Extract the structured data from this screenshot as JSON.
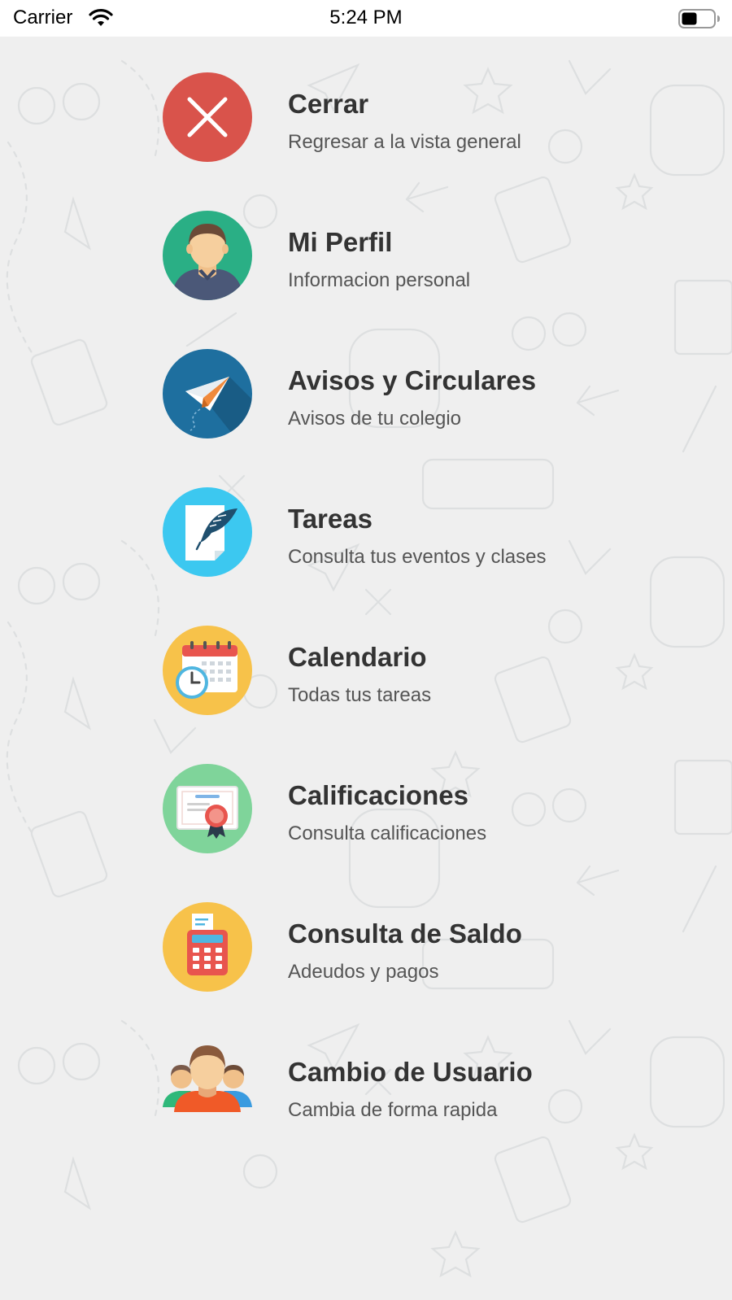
{
  "status_bar": {
    "carrier": "Carrier",
    "time": "5:24 PM",
    "wifi_icon": "wifi-icon",
    "battery_icon": "battery-icon"
  },
  "menu": {
    "items": [
      {
        "title": "Cerrar",
        "subtitle": "Regresar a la vista general",
        "icon": "close-icon",
        "color": "#d9534b"
      },
      {
        "title": "Mi Perfil",
        "subtitle": "Informacion personal",
        "icon": "user-avatar-icon",
        "color": "#2aaf85"
      },
      {
        "title": "Avisos y Circulares",
        "subtitle": "Avisos de tu colegio",
        "icon": "paper-plane-icon",
        "color": "#1e6f9f"
      },
      {
        "title": "Tareas",
        "subtitle": "Consulta tus eventos y clases",
        "icon": "quill-page-icon",
        "color": "#3cc8f0"
      },
      {
        "title": "Calendario",
        "subtitle": "Todas tus tareas",
        "icon": "calendar-clock-icon",
        "color": "#f7c24a"
      },
      {
        "title": "Calificaciones",
        "subtitle": "Consulta calificaciones",
        "icon": "certificate-icon",
        "color": "#7fd49a"
      },
      {
        "title": "Consulta de Saldo",
        "subtitle": "Adeudos y pagos",
        "icon": "cash-register-icon",
        "color": "#f7c24a"
      },
      {
        "title": "Cambio de Usuario",
        "subtitle": "Cambia de forma rapida",
        "icon": "users-group-icon",
        "color": "#f05a28"
      }
    ]
  }
}
